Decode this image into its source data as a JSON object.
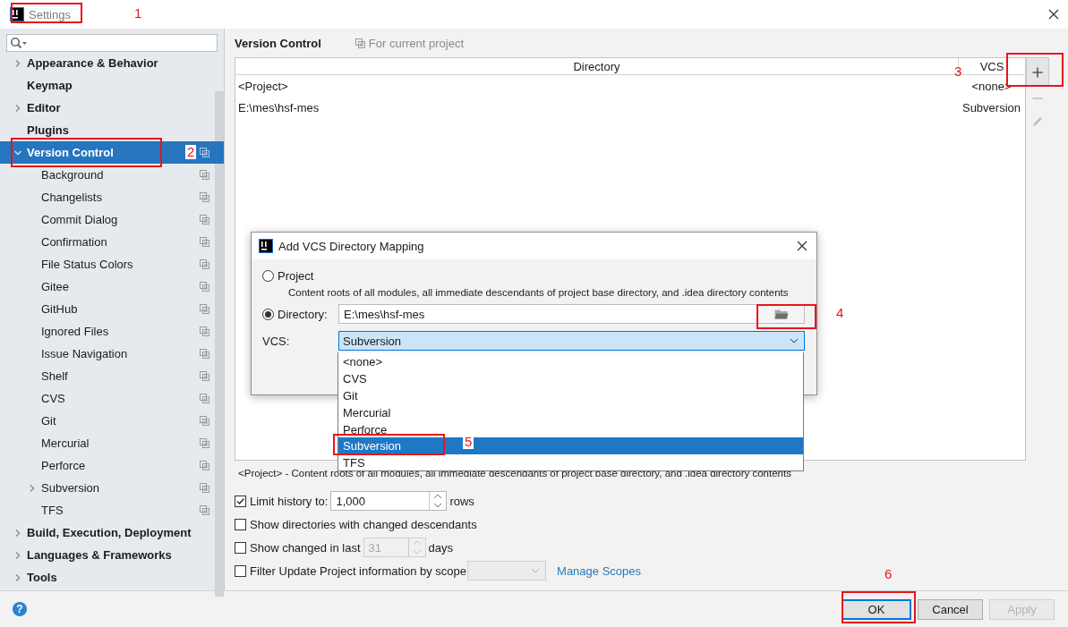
{
  "window": {
    "title": "Settings"
  },
  "sidebar": {
    "items": [
      {
        "label": "Appearance & Behavior",
        "kind": "folder",
        "expanded": false,
        "selected": false,
        "scoped": false
      },
      {
        "label": "Keymap",
        "kind": "page",
        "selected": false,
        "scoped": false
      },
      {
        "label": "Editor",
        "kind": "folder",
        "expanded": false,
        "selected": false,
        "scoped": false
      },
      {
        "label": "Plugins",
        "kind": "page",
        "selected": false,
        "scoped": false
      },
      {
        "label": "Version Control",
        "kind": "folder",
        "expanded": true,
        "selected": true,
        "scoped": true,
        "children": [
          {
            "label": "Background",
            "kind": "page",
            "selected": false,
            "scoped": true
          },
          {
            "label": "Changelists",
            "kind": "page",
            "selected": false,
            "scoped": true
          },
          {
            "label": "Commit Dialog",
            "kind": "page",
            "selected": false,
            "scoped": true
          },
          {
            "label": "Confirmation",
            "kind": "page",
            "selected": false,
            "scoped": true
          },
          {
            "label": "File Status Colors",
            "kind": "page",
            "selected": false,
            "scoped": true
          },
          {
            "label": "Gitee",
            "kind": "page",
            "selected": false,
            "scoped": true
          },
          {
            "label": "GitHub",
            "kind": "page",
            "selected": false,
            "scoped": true
          },
          {
            "label": "Ignored Files",
            "kind": "page",
            "selected": false,
            "scoped": true
          },
          {
            "label": "Issue Navigation",
            "kind": "page",
            "selected": false,
            "scoped": true
          },
          {
            "label": "Shelf",
            "kind": "page",
            "selected": false,
            "scoped": true
          },
          {
            "label": "CVS",
            "kind": "page",
            "selected": false,
            "scoped": true
          },
          {
            "label": "Git",
            "kind": "page",
            "selected": false,
            "scoped": true
          },
          {
            "label": "Mercurial",
            "kind": "page",
            "selected": false,
            "scoped": true
          },
          {
            "label": "Perforce",
            "kind": "page",
            "selected": false,
            "scoped": true
          },
          {
            "label": "Subversion",
            "kind": "folder",
            "expanded": false,
            "selected": false,
            "scoped": true
          },
          {
            "label": "TFS",
            "kind": "page",
            "selected": false,
            "scoped": true
          }
        ]
      },
      {
        "label": "Build, Execution, Deployment",
        "kind": "folder",
        "expanded": false,
        "selected": false,
        "scoped": false
      },
      {
        "label": "Languages & Frameworks",
        "kind": "folder",
        "expanded": false,
        "selected": false,
        "scoped": false
      },
      {
        "label": "Tools",
        "kind": "folder",
        "expanded": false,
        "selected": false,
        "scoped": false
      }
    ]
  },
  "panel": {
    "title": "Version Control",
    "scope_note": "For current project",
    "columns": [
      "Directory",
      "VCS"
    ],
    "rows": [
      {
        "directory": "<Project>",
        "vcs": "<none>"
      },
      {
        "directory": "E:\\mes\\hsf-mes",
        "vcs": "Subversion"
      }
    ],
    "toolbar": [
      {
        "kind": "add",
        "disabled": false
      },
      {
        "kind": "remove",
        "disabled": true
      },
      {
        "kind": "edit",
        "disabled": true
      }
    ],
    "hint": "<Project> - Content roots of all modules, all immediate descendants of project base directory, and .idea directory contents",
    "options": [
      {
        "kind": "number",
        "label": "Limit history to:",
        "checked": true,
        "value": "1,000",
        "suffix": "rows",
        "disabled": false
      },
      {
        "kind": "plain",
        "label": "Show directories with changed descendants",
        "checked": false
      },
      {
        "kind": "number",
        "label": "Show changed in last",
        "checked": false,
        "value": "31",
        "suffix": "days",
        "disabled": true
      },
      {
        "kind": "scope",
        "label": "Filter Update Project information by scope",
        "checked": false,
        "link": "Manage Scopes"
      }
    ]
  },
  "dialog": {
    "title": "Add VCS Directory Mapping",
    "choices": [
      {
        "label": "Project",
        "selected": false,
        "description": "Content roots of all modules, all immediate descendants of project base directory, and .idea directory contents"
      },
      {
        "label": "Directory:",
        "selected": true,
        "value": "E:\\mes\\hsf-mes"
      }
    ],
    "vcs_label": "VCS:",
    "vcs_value": "Subversion",
    "vcs_options": [
      {
        "label": "<none>",
        "selected": false
      },
      {
        "label": "CVS",
        "selected": false
      },
      {
        "label": "Git",
        "selected": false
      },
      {
        "label": "Mercurial",
        "selected": false
      },
      {
        "label": "Perforce",
        "selected": false
      },
      {
        "label": "Subversion",
        "selected": true
      },
      {
        "label": "TFS",
        "selected": false
      }
    ]
  },
  "footer": {
    "help": "?",
    "buttons": [
      {
        "label": "OK",
        "default": true,
        "disabled": false
      },
      {
        "label": "Cancel",
        "default": false,
        "disabled": false
      },
      {
        "label": "Apply",
        "default": false,
        "disabled": true
      }
    ]
  },
  "annotations": [
    "1",
    "2",
    "3",
    "4",
    "5",
    "6"
  ]
}
